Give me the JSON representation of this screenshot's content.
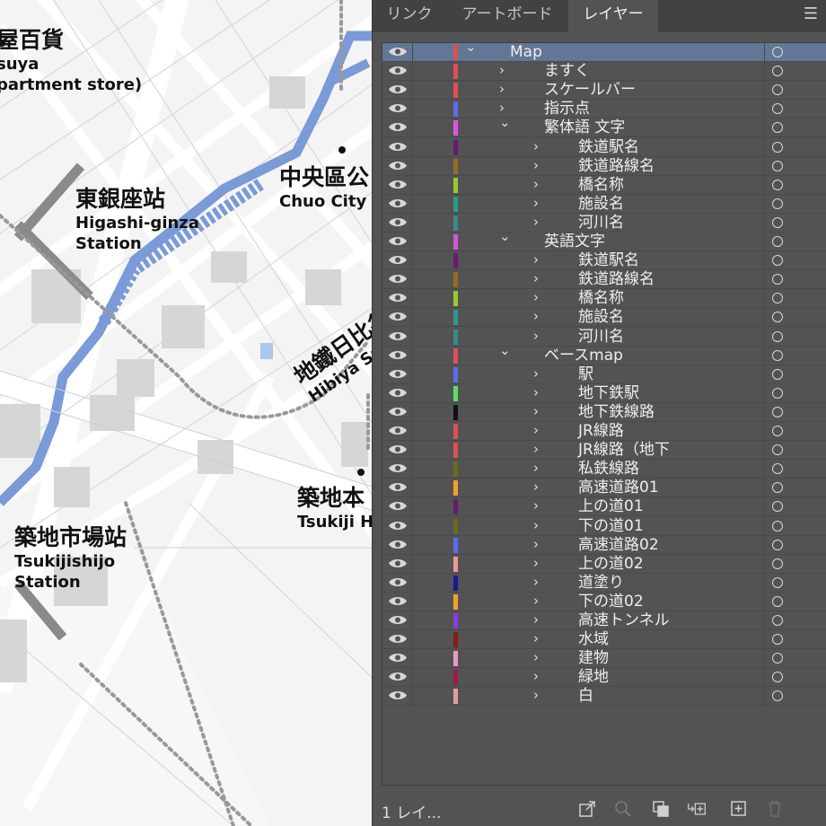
{
  "map": {
    "labels": {
      "dept_jp": "屋百貨",
      "dept_en1": "suya",
      "dept_en2": "partment store)",
      "higashi_jp": "東銀座站",
      "higashi_en1": "Higashi-ginza",
      "higashi_en2": "Station",
      "chuo_jp": "中央區公",
      "chuo_en": "Chuo City O",
      "hibiya_jp": "地鐵日比谷",
      "hibiya_en": "Hibiya Sub",
      "tsukiji_jp": "築地本",
      "tsukiji_en": "Tsukiji H",
      "shijo_jp": "築地市場站",
      "shijo_en1": "Tsukijishijo",
      "shijo_en2": "Station"
    }
  },
  "panel": {
    "tabs": [
      {
        "label": "リンク",
        "active": false
      },
      {
        "label": "アートボード",
        "active": false
      },
      {
        "label": "レイヤー",
        "active": true
      }
    ],
    "menu_icon": "hamburger-icon",
    "layers": [
      {
        "name": "Map",
        "color": "#e05050",
        "level": 0,
        "expanded": true,
        "selected": true
      },
      {
        "name": "ますく",
        "color": "#e05050",
        "level": 1,
        "expanded": false
      },
      {
        "name": "スケールバー",
        "color": "#e05050",
        "level": 1,
        "expanded": false
      },
      {
        "name": "指示点",
        "color": "#5a6cf0",
        "level": 1,
        "expanded": false
      },
      {
        "name": "繁体語 文字",
        "color": "#e055e0",
        "level": 1,
        "expanded": true
      },
      {
        "name": "鉄道駅名",
        "color": "#6a1a70",
        "level": 2,
        "expanded": false
      },
      {
        "name": "鉄道路線名",
        "color": "#9a6a22",
        "level": 2,
        "expanded": false
      },
      {
        "name": "橋名称",
        "color": "#9ac832",
        "level": 2,
        "expanded": false
      },
      {
        "name": "施設名",
        "color": "#2a9a8a",
        "level": 2,
        "expanded": false
      },
      {
        "name": "河川名",
        "color": "#3a8a8a",
        "level": 2,
        "expanded": false
      },
      {
        "name": "英語文字",
        "color": "#d055e0",
        "level": 1,
        "expanded": true
      },
      {
        "name": "鉄道駅名",
        "color": "#6a1a70",
        "level": 2,
        "expanded": false
      },
      {
        "name": "鉄道路線名",
        "color": "#9a6a22",
        "level": 2,
        "expanded": false
      },
      {
        "name": "橋名称",
        "color": "#9ac832",
        "level": 2,
        "expanded": false
      },
      {
        "name": "施設名",
        "color": "#2a9a8a",
        "level": 2,
        "expanded": false
      },
      {
        "name": "河川名",
        "color": "#3a8a8a",
        "level": 2,
        "expanded": false
      },
      {
        "name": "ベースmap",
        "color": "#e05050",
        "level": 1,
        "expanded": true
      },
      {
        "name": "駅",
        "color": "#5a6cf0",
        "level": 2,
        "expanded": false
      },
      {
        "name": "地下鉄駅",
        "color": "#5ee05e",
        "level": 2,
        "expanded": false
      },
      {
        "name": "地下鉄線路",
        "color": "#111111",
        "level": 2,
        "expanded": false
      },
      {
        "name": "JR線路",
        "color": "#e05050",
        "level": 2,
        "expanded": false
      },
      {
        "name": "JR線路（地下",
        "color": "#e05050",
        "level": 2,
        "expanded": false
      },
      {
        "name": "私鉄線路",
        "color": "#6a6a22",
        "level": 2,
        "expanded": false
      },
      {
        "name": "高速道路01",
        "color": "#f0a030",
        "level": 2,
        "expanded": false
      },
      {
        "name": "上の道01",
        "color": "#6a1a70",
        "level": 2,
        "expanded": false
      },
      {
        "name": "下の道01",
        "color": "#6a6a22",
        "level": 2,
        "expanded": false
      },
      {
        "name": "高速道路02",
        "color": "#5a6cf0",
        "level": 2,
        "expanded": false
      },
      {
        "name": "上の道02",
        "color": "#e89a9a",
        "level": 2,
        "expanded": false
      },
      {
        "name": "道塗り",
        "color": "#1a1a90",
        "level": 2,
        "expanded": false
      },
      {
        "name": "下の道02",
        "color": "#f0a030",
        "level": 2,
        "expanded": false
      },
      {
        "name": "高速トンネル",
        "color": "#8a3ae0",
        "level": 2,
        "expanded": false
      },
      {
        "name": "水域",
        "color": "#8a1a1a",
        "level": 2,
        "expanded": false
      },
      {
        "name": "建物",
        "color": "#e89ac8",
        "level": 2,
        "expanded": false
      },
      {
        "name": "緑地",
        "color": "#a01a4a",
        "level": 2,
        "expanded": false
      },
      {
        "name": "白",
        "color": "#e89a9a",
        "level": 2,
        "expanded": false
      }
    ],
    "status": "1 レイ..."
  }
}
